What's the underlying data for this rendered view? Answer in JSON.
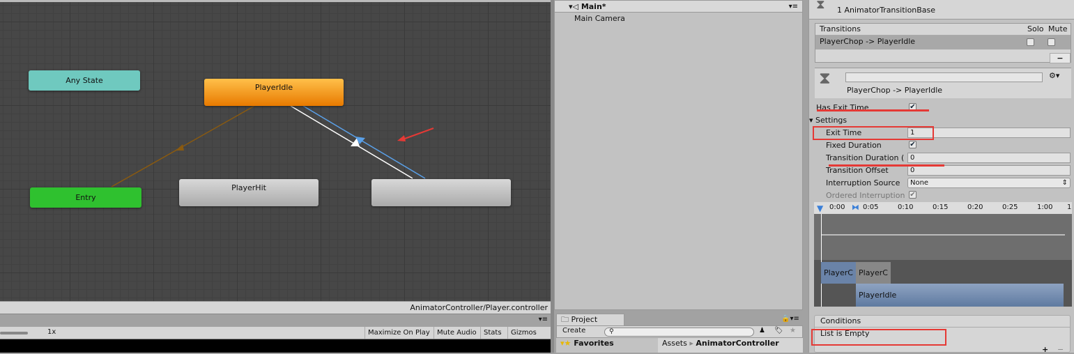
{
  "graph": {
    "nodes": {
      "any_state": "Any State",
      "player_idle": "PlayerIdle",
      "entry": "Entry",
      "player_hit": "PlayerHit"
    },
    "colors": {
      "any_state": "#6fc9bf",
      "player_idle": "#f08a0a",
      "entry": "#2fc12f",
      "default": "#bdbdbd",
      "selected_transition": "#5aa0e8"
    }
  },
  "status_bar": {
    "path": "AnimatorController/Player.controller"
  },
  "game_toolbar": {
    "scale": "1x",
    "maximize": "Maximize On Play",
    "mute": "Mute Audio",
    "stats": "Stats",
    "gizmos": "Gizmos"
  },
  "hierarchy": {
    "scene": "Main*",
    "items": [
      "Main Camera"
    ]
  },
  "project": {
    "tab": "Project",
    "create": "Create",
    "favorites": "Favorites",
    "breadcrumb_root": "Assets",
    "breadcrumb_current": "AnimatorController"
  },
  "inspector": {
    "header_subtitle": "1 AnimatorTransitionBase",
    "transitions": {
      "header": "Transitions",
      "solo": "Solo",
      "mute": "Mute",
      "items": [
        "PlayerChop -> PlayerIdle"
      ],
      "remove": "−"
    },
    "transition_name": "PlayerChop -> PlayerIdle",
    "has_exit_time": {
      "label": "Has Exit Time",
      "checked": true
    },
    "settings": {
      "label": "Settings",
      "exit_time": {
        "label": "Exit Time",
        "value": "1"
      },
      "fixed_duration": {
        "label": "Fixed Duration",
        "checked": true
      },
      "transition_duration": {
        "label": "Transition Duration (",
        "value": "0"
      },
      "transition_offset": {
        "label": "Transition Offset",
        "value": "0"
      },
      "interruption_source": {
        "label": "Interruption Source",
        "value": "None"
      },
      "ordered_interruption": {
        "label": "Ordered Interruption",
        "checked": true
      }
    },
    "timeline": {
      "ticks": [
        "0:00",
        "0:05",
        "0:10",
        "0:15",
        "0:20",
        "0:25",
        "1:00",
        "1"
      ],
      "clips": {
        "source_a": "PlayerC",
        "source_b": "PlayerC",
        "dest": "PlayerIdle"
      }
    },
    "conditions": {
      "header": "Conditions",
      "empty": "List is Empty",
      "add": "+",
      "remove": "−"
    }
  }
}
